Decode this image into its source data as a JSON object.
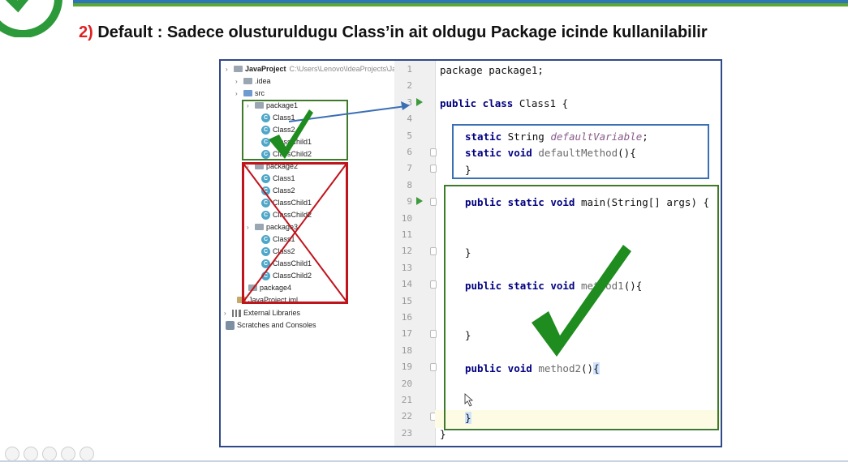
{
  "heading": {
    "number": "2)",
    "text": "Default : Sadece olusturuldugu Class’in ait oldugu Package icinde kullanilabilir"
  },
  "project_tree": [
    {
      "name": "JavaProject",
      "path": "C:\\Users\\Lenovo\\IdeaProjects\\Ja",
      "icon": "folder-icon"
    },
    {
      "name": ".idea",
      "icon": "folder-icon"
    },
    {
      "name": "src",
      "icon": "folder-icon"
    },
    {
      "name": "package1",
      "icon": "package-icon"
    },
    {
      "name": "Class1",
      "icon": "class-icon"
    },
    {
      "name": "Class2",
      "icon": "class-icon"
    },
    {
      "name": "ClassChild1",
      "icon": "class-icon"
    },
    {
      "name": "ClassChild2",
      "icon": "class-icon"
    },
    {
      "name": "package2",
      "icon": "package-icon"
    },
    {
      "name": "Class1",
      "icon": "class-icon"
    },
    {
      "name": "Class2",
      "icon": "class-icon"
    },
    {
      "name": "ClassChild1",
      "icon": "class-icon"
    },
    {
      "name": "ClassChild2",
      "icon": "class-icon"
    },
    {
      "name": "package3",
      "icon": "package-icon"
    },
    {
      "name": "Class1",
      "icon": "class-icon"
    },
    {
      "name": "Class2",
      "icon": "class-icon"
    },
    {
      "name": "ClassChild1",
      "icon": "class-icon"
    },
    {
      "name": "ClassChild2",
      "icon": "class-icon"
    },
    {
      "name": "package4",
      "icon": "package-icon"
    },
    {
      "name": "JavaProject.iml",
      "icon": "file-icon"
    },
    {
      "name": "External Libraries",
      "icon": "library-icon"
    },
    {
      "name": "Scratches and Consoles",
      "icon": "scratch-icon"
    }
  ],
  "line_numbers": [
    "1",
    "2",
    "3",
    "4",
    "5",
    "6",
    "7",
    "8",
    "9",
    "10",
    "11",
    "12",
    "13",
    "14",
    "15",
    "16",
    "17",
    "18",
    "19",
    "20",
    "21",
    "22",
    "23"
  ],
  "code": {
    "l1": "package package1;",
    "l3_kw": "public class",
    "l3_rest": " Class1 {",
    "l5_kw": "static",
    "l5_type": " String ",
    "l5_var": "defaultVariable",
    "l5_end": ";",
    "l6_kw": "static void",
    "l6_fn": " defaultMethod",
    "l6_end": "(){",
    "l7": "}",
    "l9_kw": "public static void",
    "l9_rest": " main(String[] args) {",
    "l12": "}",
    "l14_kw": "public static void",
    "l14_fn": " method1",
    "l14_end": "(){",
    "l17": "}",
    "l19_kw": "public void",
    "l19_fn": " method2",
    "l19_end": "()",
    "l19_brace": "{",
    "l22": "}",
    "l23": "}"
  },
  "colors": {
    "red": "#c0141c",
    "green": "#3f7a2a",
    "blue": "#3a6fb4",
    "check": "#1e8c1e"
  }
}
